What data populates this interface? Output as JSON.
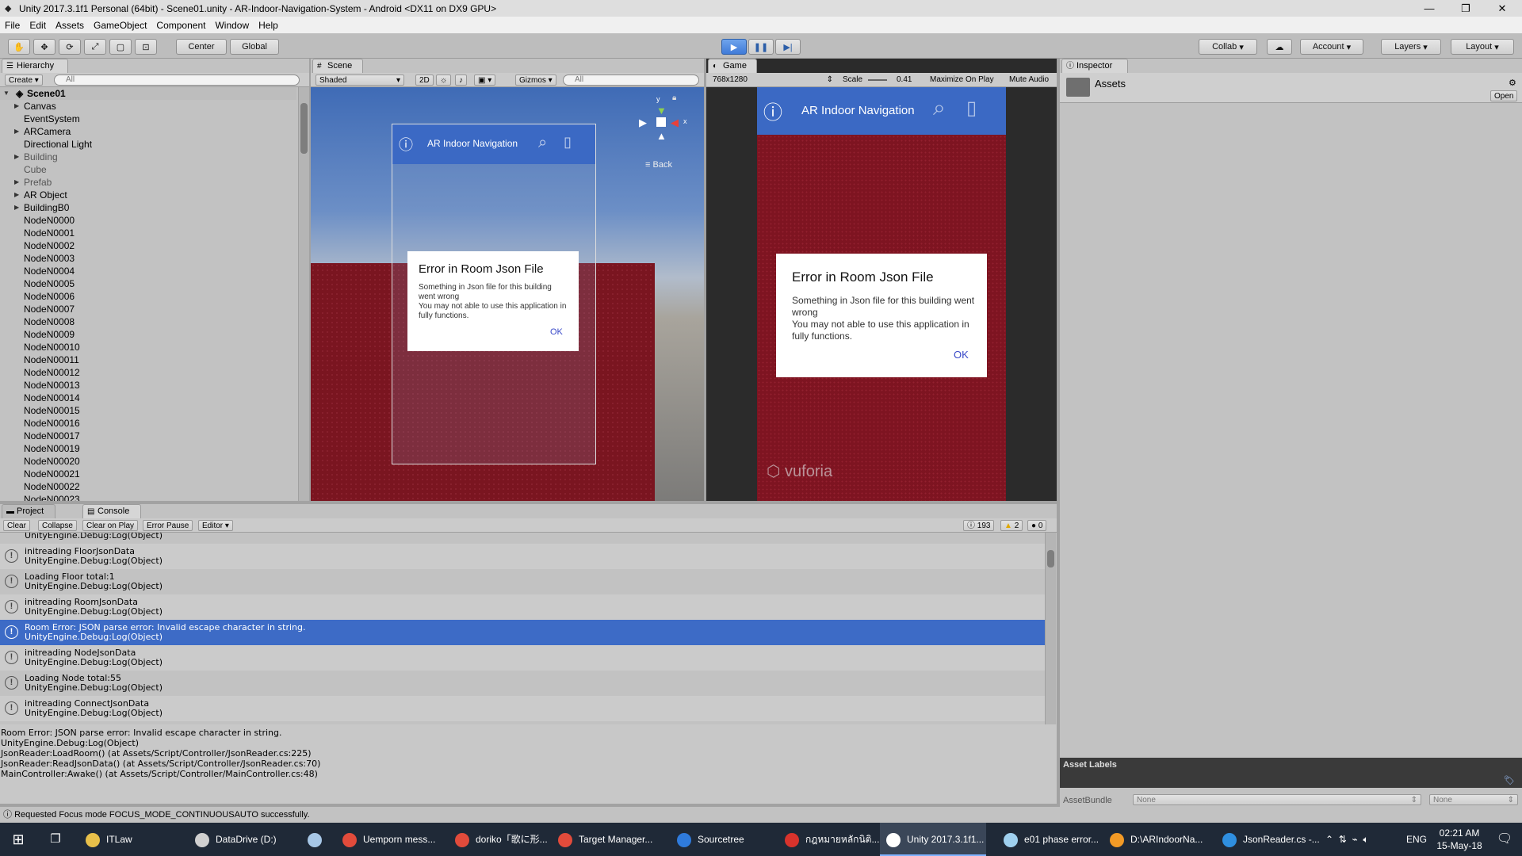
{
  "window": {
    "title": "Unity 2017.3.1f1 Personal (64bit) - Scene01.unity - AR-Indoor-Navigation-System - Android <DX11 on DX9 GPU>"
  },
  "menu": [
    "File",
    "Edit",
    "Assets",
    "GameObject",
    "Component",
    "Window",
    "Help"
  ],
  "toolbar": {
    "center_label": "Center",
    "global_label": "Global",
    "collab_label": "Collab",
    "account_label": "Account",
    "layers_label": "Layers",
    "layout_label": "Layout"
  },
  "hierarchy": {
    "tab_label": "Hierarchy",
    "create_label": "Create",
    "search_placeholder": "All",
    "scene_name": "Scene01",
    "items": [
      {
        "label": "Canvas",
        "arrow": "▶"
      },
      {
        "label": "EventSystem",
        "arrow": ""
      },
      {
        "label": "ARCamera",
        "arrow": "▶"
      },
      {
        "label": "Directional Light",
        "arrow": ""
      },
      {
        "label": "Building",
        "arrow": "▶"
      },
      {
        "label": "Cube",
        "arrow": ""
      },
      {
        "label": "Prefab",
        "arrow": "▶"
      },
      {
        "label": "AR Object",
        "arrow": "▶"
      },
      {
        "label": "BuildingB0",
        "arrow": "▶"
      },
      {
        "label": "NodeN0000",
        "arrow": ""
      },
      {
        "label": "NodeN0001",
        "arrow": ""
      },
      {
        "label": "NodeN0002",
        "arrow": ""
      },
      {
        "label": "NodeN0003",
        "arrow": ""
      },
      {
        "label": "NodeN0004",
        "arrow": ""
      },
      {
        "label": "NodeN0005",
        "arrow": ""
      },
      {
        "label": "NodeN0006",
        "arrow": ""
      },
      {
        "label": "NodeN0007",
        "arrow": ""
      },
      {
        "label": "NodeN0008",
        "arrow": ""
      },
      {
        "label": "NodeN0009",
        "arrow": ""
      },
      {
        "label": "NodeN00010",
        "arrow": ""
      },
      {
        "label": "NodeN00011",
        "arrow": ""
      },
      {
        "label": "NodeN00012",
        "arrow": ""
      },
      {
        "label": "NodeN00013",
        "arrow": ""
      },
      {
        "label": "NodeN00014",
        "arrow": ""
      },
      {
        "label": "NodeN00015",
        "arrow": ""
      },
      {
        "label": "NodeN00016",
        "arrow": ""
      },
      {
        "label": "NodeN00017",
        "arrow": ""
      },
      {
        "label": "NodeN00019",
        "arrow": ""
      },
      {
        "label": "NodeN00020",
        "arrow": ""
      },
      {
        "label": "NodeN00021",
        "arrow": ""
      },
      {
        "label": "NodeN00022",
        "arrow": ""
      },
      {
        "label": "NodeN00023",
        "arrow": ""
      }
    ]
  },
  "scene": {
    "tab_label": "Scene",
    "shading": "Shaded",
    "mode_2d": "2D",
    "gizmos_label": "Gizmos",
    "search_placeholder": "All",
    "gizmo_y": "y",
    "gizmo_x": "x",
    "back_label": "Back"
  },
  "game": {
    "tab_label": "Game",
    "resolution": "768x1280",
    "scale_label": "Scale",
    "scale_value": "0.41",
    "maximize_label": "Maximize On Play",
    "mute_label": "Mute Audio",
    "watermark": "vuforia"
  },
  "app": {
    "title": "AR Indoor Navigation",
    "dialog_title": "Error in Room Json File",
    "dialog_body_1": "Something in Json file for this building went wrong",
    "dialog_body_2": "You may not able to use this application in fully functions.",
    "dialog_ok": "OK"
  },
  "inspector": {
    "tab_label": "Inspector",
    "asset_name": "Assets",
    "open_label": "Open",
    "asset_labels_title": "Asset Labels",
    "assetbundle_label": "AssetBundle",
    "bundle_value": "None",
    "variant_value": "None"
  },
  "console": {
    "project_tab": "Project",
    "console_tab": "Console",
    "clear_label": "Clear",
    "collapse_label": "Collapse",
    "clear_on_play_label": "Clear on Play",
    "error_pause_label": "Error Pause",
    "editor_label": "Editor",
    "log_count": "193",
    "warn_count": "2",
    "error_count": "0",
    "top_partial": "UnityEngine.Debug:Log(Object)",
    "entries": [
      {
        "l1": "initreading FloorJsonData",
        "l2": "UnityEngine.Debug:Log(Object)",
        "selected": false
      },
      {
        "l1": "Loading Floor total:1",
        "l2": "UnityEngine.Debug:Log(Object)",
        "selected": false
      },
      {
        "l1": "initreading RoomJsonData",
        "l2": "UnityEngine.Debug:Log(Object)",
        "selected": false
      },
      {
        "l1": "Room Error: JSON parse error: Invalid escape character in string.",
        "l2": "UnityEngine.Debug:Log(Object)",
        "selected": true
      },
      {
        "l1": "initreading NodeJsonData",
        "l2": "UnityEngine.Debug:Log(Object)",
        "selected": false
      },
      {
        "l1": "Loading Node total:55",
        "l2": "UnityEngine.Debug:Log(Object)",
        "selected": false
      },
      {
        "l1": "initreading ConnectJsonData",
        "l2": "UnityEngine.Debug:Log(Object)",
        "selected": false
      }
    ],
    "stacktrace": "Room Error: JSON parse error: Invalid escape character in string.\nUnityEngine.Debug:Log(Object)\nJsonReader:LoadRoom() (at Assets/Script/Controller/JsonReader.cs:225)\nJsonReader:ReadJsonData() (at Assets/Script/Controller/JsonReader.cs:70)\nMainController:Awake() (at Assets/Script/Controller/MainController.cs:48)"
  },
  "status": {
    "text": "Requested Focus mode FOCUS_MODE_CONTINUOUSAUTO successfully."
  },
  "taskbar": {
    "items": [
      {
        "label": "ITLaw",
        "color": "#e8c04a"
      },
      {
        "label": "DataDrive (D:)",
        "color": "#d0d0d0"
      },
      {
        "label": "",
        "color": "#a7c7e7"
      },
      {
        "label": "Uemporn mess...",
        "color": "#e24b3b"
      },
      {
        "label": "doriko「歌に形...",
        "color": "#e24b3b"
      },
      {
        "label": "Target Manager...",
        "color": "#e24b3b"
      },
      {
        "label": "Sourcetree",
        "color": "#2f7bdc"
      },
      {
        "label": "กฎหมายหลักนิติ...",
        "color": "#d8332c"
      },
      {
        "label": "Unity 2017.3.1f1...",
        "color": "#ffffff"
      },
      {
        "label": "e01 phase error...",
        "color": "#9fd0ef"
      },
      {
        "label": "D:\\ARIndoorNa...",
        "color": "#f29a26"
      },
      {
        "label": "JsonReader.cs -...",
        "color": "#2f8fe0"
      }
    ],
    "lang": "ENG",
    "time": "02:21 AM",
    "date": "15-May-18"
  },
  "colors": {
    "accent_blue": "#3d6bc6",
    "app_bar_blue": "#3b69c4",
    "game_red": "#7e1421"
  }
}
